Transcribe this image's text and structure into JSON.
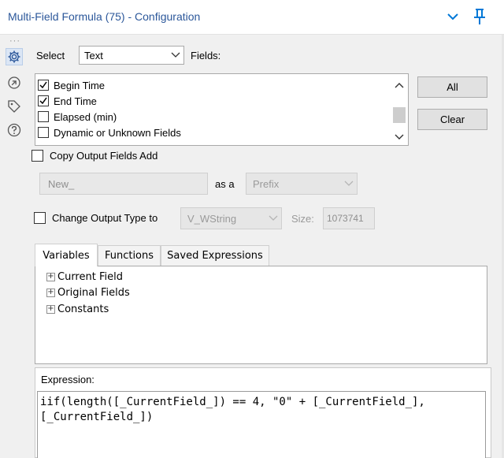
{
  "header": {
    "title": "Multi-Field Formula (75) - Configuration"
  },
  "select_row": {
    "select_label": "Select",
    "type_value": "Text",
    "fields_label": "Fields:"
  },
  "fields": [
    {
      "label": "Begin Time",
      "checked": true
    },
    {
      "label": "End Time",
      "checked": true
    },
    {
      "label": "Elapsed (min)",
      "checked": false
    },
    {
      "label": "Dynamic or Unknown Fields",
      "checked": false
    }
  ],
  "buttons": {
    "all": "All",
    "clear": "Clear"
  },
  "copy_output": {
    "label": "Copy Output Fields Add",
    "checked": false,
    "name_value": "New_",
    "as_a_label": "as a",
    "position_value": "Prefix"
  },
  "change_type": {
    "label": "Change Output Type to",
    "checked": false,
    "type_value": "V_WString",
    "size_label": "Size:",
    "size_value": "1073741"
  },
  "tabs": [
    {
      "label": "Variables",
      "active": true
    },
    {
      "label": "Functions",
      "active": false
    },
    {
      "label": "Saved Expressions",
      "active": false
    }
  ],
  "tree": [
    {
      "label": "Current Field"
    },
    {
      "label": "Original Fields"
    },
    {
      "label": "Constants"
    }
  ],
  "expression": {
    "label": "Expression:",
    "text": "iif(length([_CurrentField_]) == 4, \"0\" + [_CurrentField_],\n[_CurrentField_])"
  },
  "colors": {
    "title": "#2b579a",
    "accent": "#0078d7"
  },
  "icons": {
    "header": [
      "chevron-down-icon",
      "pin-icon"
    ],
    "rail": [
      "gear-icon",
      "arrows-icon",
      "tag-icon",
      "help-icon"
    ]
  }
}
